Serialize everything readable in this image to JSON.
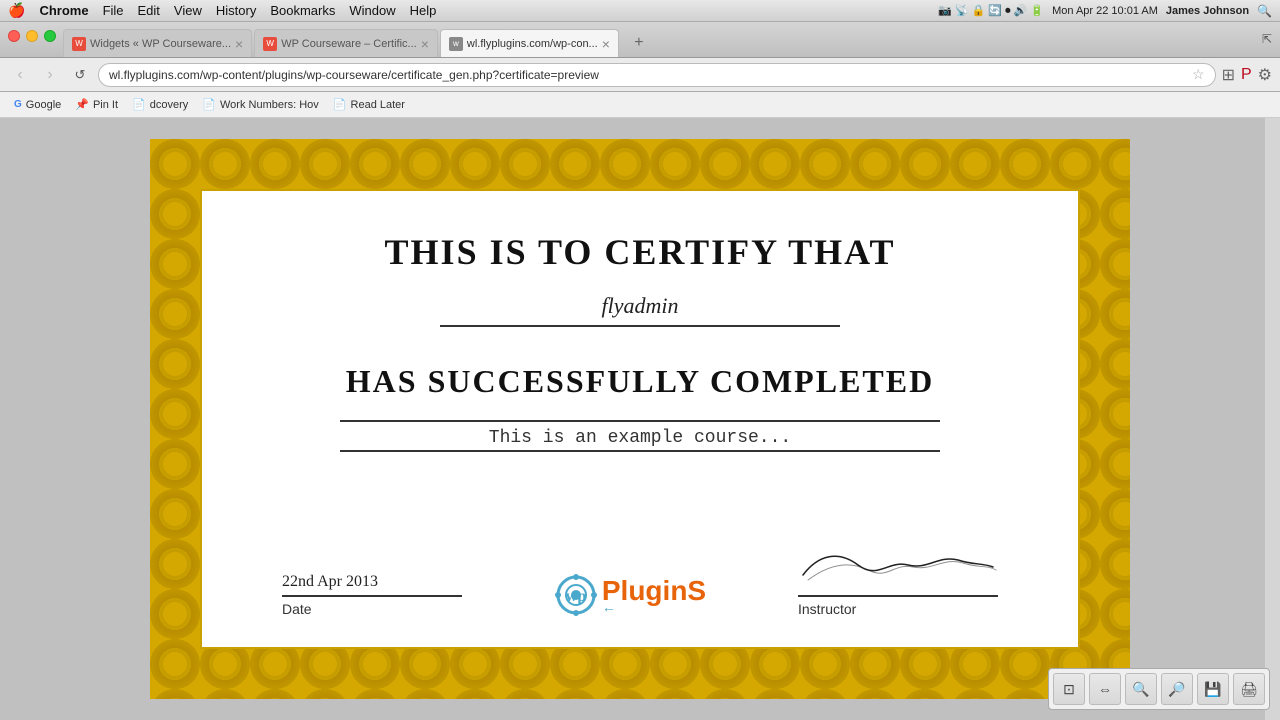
{
  "menubar": {
    "apple": "🍎",
    "items": [
      "Chrome",
      "File",
      "Edit",
      "View",
      "History",
      "Bookmarks",
      "Window",
      "Help"
    ],
    "bold_item": "Chrome",
    "right": {
      "datetime": "Mon Apr 22  10:01 AM",
      "user": "James Johnson"
    }
  },
  "tabs": [
    {
      "id": "tab1",
      "label": "Widgets « WP Courseware...",
      "favicon_color": "#e74c3c",
      "favicon_letter": "W",
      "active": false,
      "closeable": true
    },
    {
      "id": "tab2",
      "label": "WP Courseware – Certific...",
      "favicon_color": "#e74c3c",
      "favicon_letter": "W",
      "active": false,
      "closeable": true
    },
    {
      "id": "tab3",
      "label": "wl.flyplugins.com/wp-con...",
      "favicon_color": "#888",
      "favicon_letter": "w",
      "active": true,
      "closeable": true
    }
  ],
  "addressbar": {
    "url": "wl.flyplugins.com/wp-content/plugins/wp-courseware/certificate_gen.php?certificate=preview",
    "back_enabled": true,
    "forward_enabled": false
  },
  "bookmarks": [
    {
      "label": "Google",
      "icon": "G",
      "type": "google"
    },
    {
      "label": "Pin It",
      "icon": "📌",
      "type": "pin"
    },
    {
      "label": "dcovery",
      "icon": "⚙",
      "type": "generic"
    },
    {
      "label": "Work Numbers: Hov",
      "icon": "⚙",
      "type": "generic"
    },
    {
      "label": "Read Later",
      "icon": "⚙",
      "type": "generic"
    }
  ],
  "certificate": {
    "title": "THIS IS TO CERTIFY THAT",
    "name": "flyadmin",
    "subtitle": "HAS SUCCESSFULLY COMPLETED",
    "course": "This is an example course...",
    "date_label": "Date",
    "date_value": "22nd Apr 2013",
    "instructor_label": "Instructor",
    "instructor_signature": "Woodrow Wilson",
    "logo_text": "PluginS",
    "logo_symbol": "🔌"
  },
  "toolbar_buttons": [
    {
      "id": "fit-page",
      "icon": "⊡",
      "label": "Fit Page"
    },
    {
      "id": "fit-width",
      "icon": "⇔",
      "label": "Fit Width"
    },
    {
      "id": "zoom-out",
      "icon": "🔍",
      "label": "Zoom Out"
    },
    {
      "id": "zoom-in",
      "icon": "🔎",
      "label": "Zoom In"
    },
    {
      "id": "save",
      "icon": "💾",
      "label": "Save"
    },
    {
      "id": "print",
      "icon": "🖨",
      "label": "Print"
    }
  ]
}
